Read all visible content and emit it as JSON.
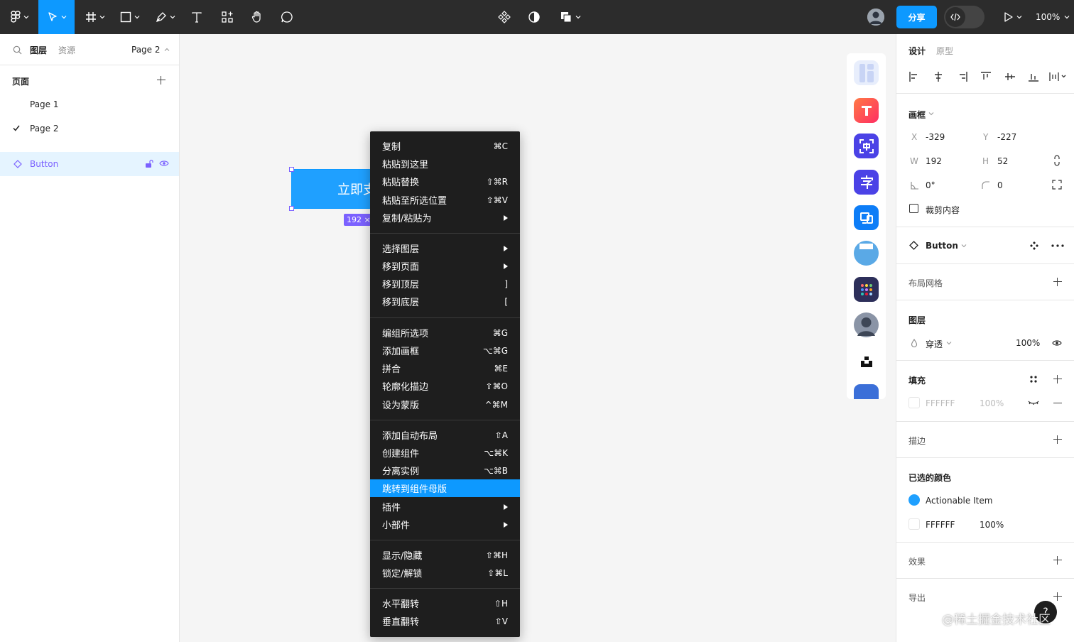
{
  "toolbar": {
    "zoom": "100%",
    "share_label": "分享"
  },
  "left_panel": {
    "tab_layers": "图层",
    "tab_assets": "资源",
    "page_selector": "Page 2",
    "pages_title": "页面",
    "pages": [
      {
        "label": "Page 1",
        "selected": false
      },
      {
        "label": "Page 2",
        "selected": true
      }
    ],
    "layer": {
      "label": "Button"
    }
  },
  "canvas": {
    "button_text": "立即支",
    "size_badge": "192 ×"
  },
  "context_menu": {
    "groups": [
      [
        {
          "label": "复制",
          "shortcut": "⌘C"
        },
        {
          "label": "粘贴到这里",
          "shortcut": ""
        },
        {
          "label": "粘贴替换",
          "shortcut": "⇧⌘R"
        },
        {
          "label": "粘贴至所选位置",
          "shortcut": "⇧⌘V"
        },
        {
          "label": "复制/粘贴为",
          "shortcut": "",
          "submenu": true
        }
      ],
      [
        {
          "label": "选择图层",
          "shortcut": "",
          "submenu": true
        },
        {
          "label": "移到页面",
          "shortcut": "",
          "submenu": true
        },
        {
          "label": "移到顶层",
          "shortcut": "]"
        },
        {
          "label": "移到底层",
          "shortcut": "["
        }
      ],
      [
        {
          "label": "编组所选项",
          "shortcut": "⌘G"
        },
        {
          "label": "添加画框",
          "shortcut": "⌥⌘G"
        },
        {
          "label": "拼合",
          "shortcut": "⌘E"
        },
        {
          "label": "轮廓化描边",
          "shortcut": "⇧⌘O"
        },
        {
          "label": "设为蒙版",
          "shortcut": "^⌘M"
        }
      ],
      [
        {
          "label": "添加自动布局",
          "shortcut": "⇧A"
        },
        {
          "label": "创建组件",
          "shortcut": "⌥⌘K"
        },
        {
          "label": "分离实例",
          "shortcut": "⌥⌘B"
        },
        {
          "label": "跳转到组件母版",
          "shortcut": "",
          "active": true
        },
        {
          "label": "插件",
          "shortcut": "",
          "submenu": true
        },
        {
          "label": "小部件",
          "shortcut": "",
          "submenu": true
        }
      ],
      [
        {
          "label": "显示/隐藏",
          "shortcut": "⇧⌘H"
        },
        {
          "label": "锁定/解锁",
          "shortcut": "⇧⌘L"
        }
      ],
      [
        {
          "label": "水平翻转",
          "shortcut": "⇧H"
        },
        {
          "label": "垂直翻转",
          "shortcut": "⇧V"
        }
      ]
    ]
  },
  "right_panel": {
    "tab_design": "设计",
    "tab_prototype": "原型",
    "frame_title": "画框",
    "x_label": "X",
    "x_value": "-329",
    "y_label": "Y",
    "y_value": "-227",
    "w_label": "W",
    "w_value": "192",
    "h_label": "H",
    "h_value": "52",
    "rotation": "0°",
    "radius": "0",
    "clip_content": "裁剪内容",
    "component_name": "Button",
    "layout_grid": "布局网格",
    "layer_title": "图层",
    "blend_mode": "穿透",
    "layer_opacity": "100%",
    "fill_title": "填充",
    "fill_hex": "FFFFFF",
    "fill_opacity": "100%",
    "stroke_title": "描边",
    "selected_colors_title": "已选的颜色",
    "selected_colors": [
      {
        "name": "Actionable Item",
        "opacity": "",
        "color": "#1fa0ff"
      },
      {
        "name": "FFFFFF",
        "opacity": "100%",
        "color": "#ffffff"
      }
    ],
    "effects_title": "效果",
    "export_title": "导出"
  },
  "watermark": "@稀土掘金技术社区",
  "help_label": "?",
  "colors": {
    "accent": "#0d99ff",
    "toolbar_bg": "#2c2c2c",
    "menu_bg": "#1e1e1e",
    "component_purple": "#7b61ff"
  }
}
